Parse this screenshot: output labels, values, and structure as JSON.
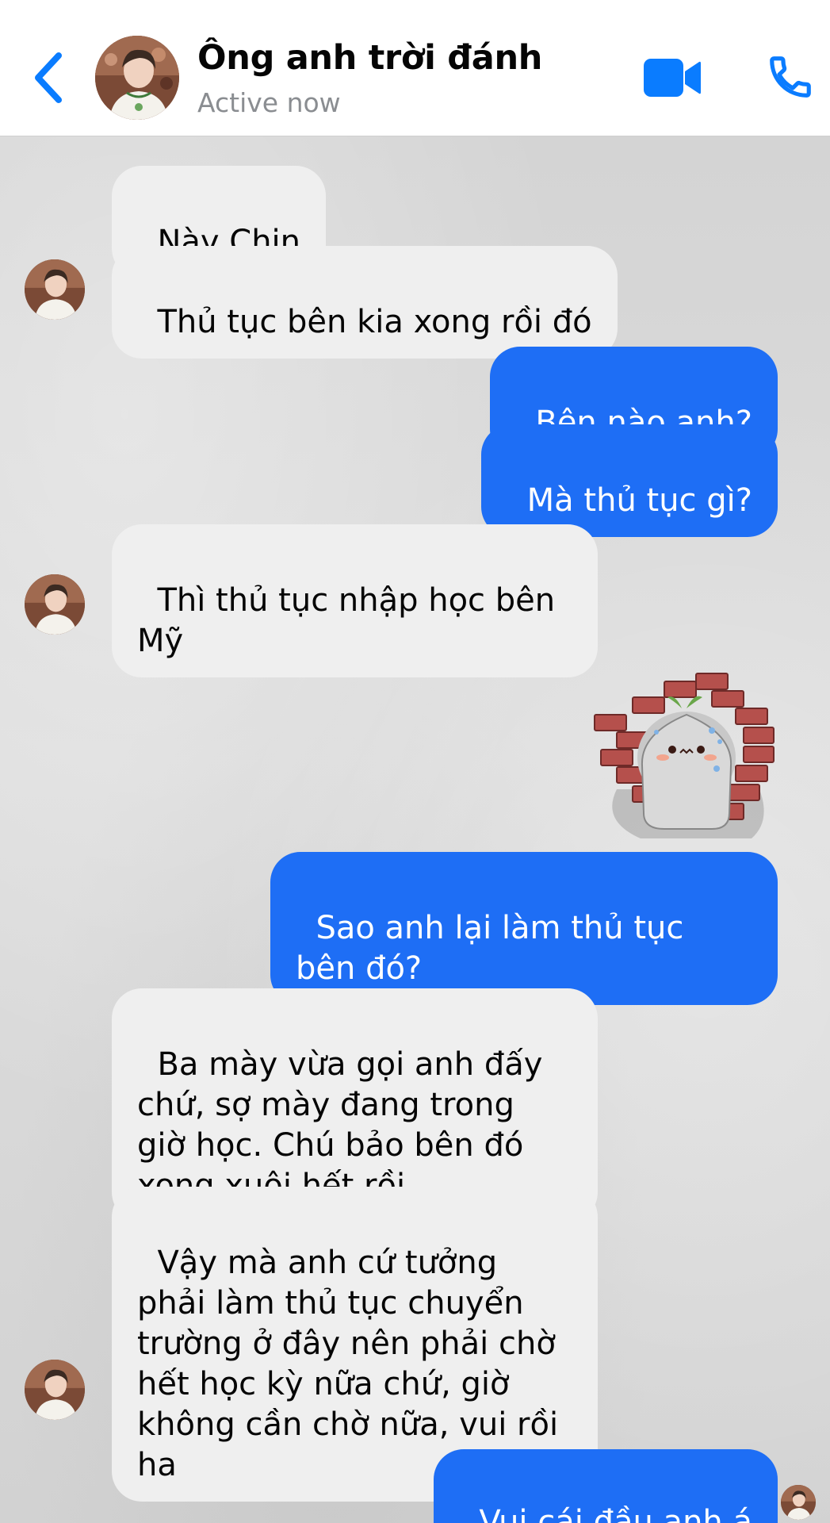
{
  "header": {
    "contact_name": "Ông anh trời đánh",
    "status": "Active now",
    "icons": {
      "back": "chevron-left-icon",
      "video": "video-camera-icon",
      "call": "phone-icon"
    },
    "accent_color": "#0a7cff"
  },
  "messages": [
    {
      "side": "in",
      "text": "Này Chin"
    },
    {
      "side": "in",
      "text": "Thủ tục bên kia xong rồi đó"
    },
    {
      "side": "out",
      "text": "Bên nào anh?"
    },
    {
      "side": "out",
      "text": "Mà thủ tục gì?"
    },
    {
      "side": "in",
      "text": "Thì thủ tục nhập học bên Mỹ"
    },
    {
      "side": "out",
      "type": "sticker",
      "sticker": "crying-bun-brick-wall-sticker"
    },
    {
      "side": "out",
      "text": "Sao anh lại làm thủ tục bên đó?"
    },
    {
      "side": "in",
      "text": "Ba mày vừa gọi anh đấy chứ, sợ mày đang trong giờ học. Chú bảo bên đó xong xuôi hết rồi"
    },
    {
      "side": "in",
      "text": "Vậy mà anh cứ tưởng phải làm thủ tục chuyển trường ở đây nên phải chờ hết học kỳ nữa chứ, giờ không cần chờ nữa, vui rồi ha"
    },
    {
      "side": "out",
      "text": "Vui cái đầu anh á",
      "emoji": "😤"
    }
  ],
  "colors": {
    "incoming_bubble": "#efefef",
    "outgoing_bubble": "#1e6ef5",
    "header_bg": "#ffffff"
  }
}
